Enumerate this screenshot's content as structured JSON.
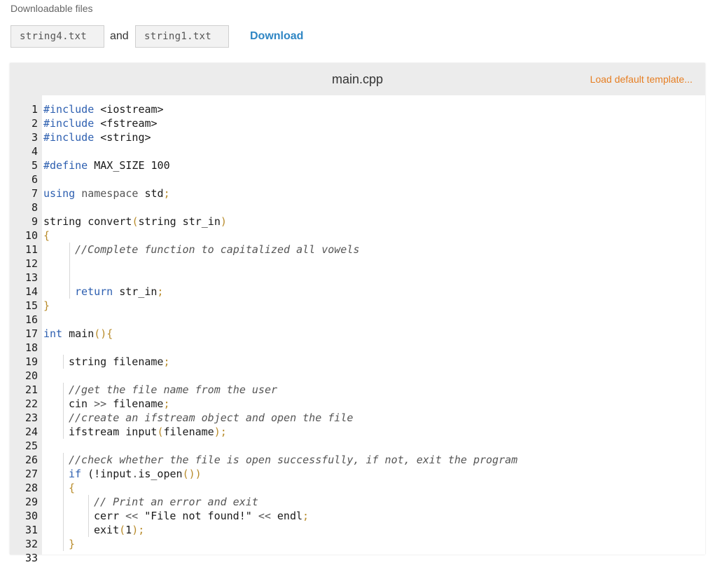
{
  "downloads": {
    "label": "Downloadable files",
    "file1": "string4.txt",
    "and_text": "and",
    "file2": "string1.txt",
    "download_label": "Download"
  },
  "editor": {
    "filename": "main.cpp",
    "load_template_label": "Load default template..."
  },
  "code": {
    "line_numbers": [
      "1",
      "2",
      "3",
      "4",
      "5",
      "6",
      "7",
      "8",
      "9",
      "10",
      "11",
      "12",
      "13",
      "14",
      "15",
      "16",
      "17",
      "18",
      "19",
      "20",
      "21",
      "22",
      "23",
      "24",
      "25",
      "26",
      "27",
      "28",
      "29",
      "30",
      "31",
      "32",
      "33"
    ],
    "lines": [
      {
        "indent": 0,
        "tokens": [
          {
            "t": "#include",
            "c": "pp"
          },
          {
            "t": " <iostream>"
          }
        ]
      },
      {
        "indent": 0,
        "tokens": [
          {
            "t": "#include",
            "c": "pp"
          },
          {
            "t": " <fstream>"
          }
        ]
      },
      {
        "indent": 0,
        "tokens": [
          {
            "t": "#include",
            "c": "pp"
          },
          {
            "t": " <string>"
          }
        ]
      },
      {
        "indent": 0,
        "tokens": []
      },
      {
        "indent": 0,
        "tokens": [
          {
            "t": "#define",
            "c": "pp"
          },
          {
            "t": " MAX_SIZE 100"
          }
        ]
      },
      {
        "indent": 0,
        "tokens": []
      },
      {
        "indent": 0,
        "tokens": [
          {
            "t": "using",
            "c": "kw"
          },
          {
            "t": " "
          },
          {
            "t": "namespace",
            "c": "op"
          },
          {
            "t": " std"
          },
          {
            "t": ";",
            "c": "pn"
          }
        ]
      },
      {
        "indent": 0,
        "tokens": []
      },
      {
        "indent": 0,
        "tokens": [
          {
            "t": "string convert"
          },
          {
            "t": "(",
            "c": "pn"
          },
          {
            "t": "string str_in"
          },
          {
            "t": ")",
            "c": "pn"
          }
        ]
      },
      {
        "indent": 0,
        "tokens": [
          {
            "t": "{",
            "c": "pn"
          }
        ]
      },
      {
        "indent": 1,
        "tokens": [
          {
            "t": "//Complete function to capitalized all vowels",
            "c": "cm"
          }
        ]
      },
      {
        "indent": 1,
        "tokens": []
      },
      {
        "indent": 1,
        "tokens": []
      },
      {
        "indent": 1,
        "tokens": [
          {
            "t": "return",
            "c": "kw"
          },
          {
            "t": " str_in"
          },
          {
            "t": ";",
            "c": "pn"
          }
        ]
      },
      {
        "indent": 0,
        "tokens": [
          {
            "t": "}",
            "c": "pn"
          }
        ]
      },
      {
        "indent": 0,
        "tokens": []
      },
      {
        "indent": 0,
        "tokens": [
          {
            "t": "int",
            "c": "kw"
          },
          {
            "t": " main"
          },
          {
            "t": "(){",
            "c": "pn"
          }
        ]
      },
      {
        "indent": 0,
        "tokens": []
      },
      {
        "indent": 2,
        "tokens": [
          {
            "t": "string filename"
          },
          {
            "t": ";",
            "c": "pn"
          }
        ]
      },
      {
        "indent": 0,
        "tokens": []
      },
      {
        "indent": 2,
        "tokens": [
          {
            "t": "//get the file name from the user",
            "c": "cm"
          }
        ]
      },
      {
        "indent": 2,
        "tokens": [
          {
            "t": "cin "
          },
          {
            "t": ">>",
            "c": "op"
          },
          {
            "t": " filename"
          },
          {
            "t": ";",
            "c": "pn"
          }
        ]
      },
      {
        "indent": 2,
        "tokens": [
          {
            "t": "//create an ifstream object and open the file",
            "c": "cm"
          }
        ]
      },
      {
        "indent": 2,
        "tokens": [
          {
            "t": "ifstream input"
          },
          {
            "t": "(",
            "c": "pn"
          },
          {
            "t": "filename"
          },
          {
            "t": ");",
            "c": "pn"
          }
        ]
      },
      {
        "indent": 0,
        "tokens": []
      },
      {
        "indent": 2,
        "tokens": [
          {
            "t": "//check whether the file is open successfully, if not, exit the program",
            "c": "cm"
          }
        ]
      },
      {
        "indent": 2,
        "tokens": [
          {
            "t": "if",
            "c": "kw"
          },
          {
            "t": " ("
          },
          {
            "t": "!input",
            "c": ""
          },
          {
            "t": ".",
            "c": "op"
          },
          {
            "t": "is_open"
          },
          {
            "t": "())",
            "c": "pn"
          }
        ]
      },
      {
        "indent": 2,
        "tokens": [
          {
            "t": "{",
            "c": "pn"
          }
        ]
      },
      {
        "indent": 3,
        "tokens": [
          {
            "t": "// Print an error and exit",
            "c": "cm"
          }
        ]
      },
      {
        "indent": 3,
        "tokens": [
          {
            "t": "cerr "
          },
          {
            "t": "<<",
            "c": "op"
          },
          {
            "t": " \"File not found!\" "
          },
          {
            "t": "<<",
            "c": "op"
          },
          {
            "t": " endl"
          },
          {
            "t": ";",
            "c": "pn"
          }
        ]
      },
      {
        "indent": 3,
        "tokens": [
          {
            "t": "exit"
          },
          {
            "t": "(",
            "c": "pn"
          },
          {
            "t": "1"
          },
          {
            "t": ");",
            "c": "pn"
          }
        ]
      },
      {
        "indent": 2,
        "tokens": [
          {
            "t": "}",
            "c": "pn"
          }
        ]
      },
      {
        "indent": 0,
        "tokens": []
      }
    ]
  }
}
